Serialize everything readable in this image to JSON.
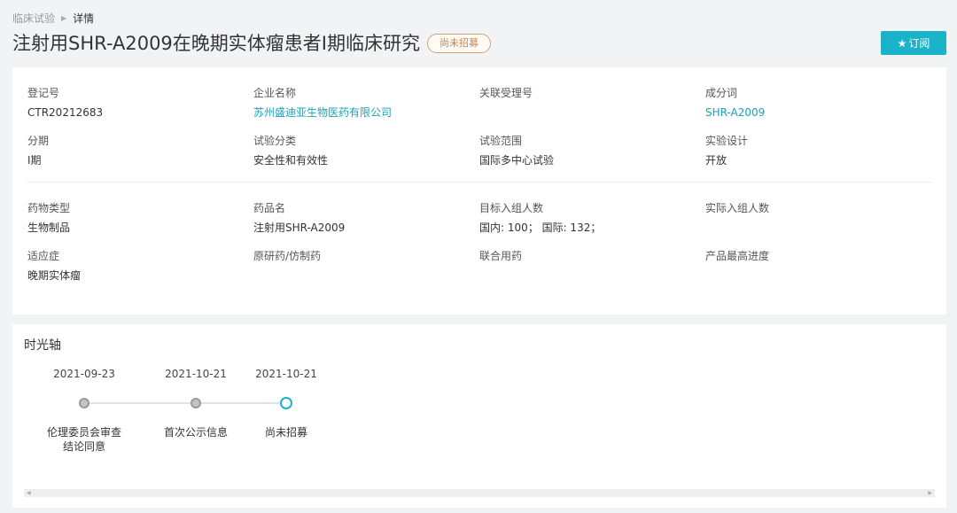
{
  "breadcrumb": {
    "root": "临床试验",
    "current": "详情"
  },
  "header": {
    "title": "注射用SHR-A2009在晚期实体瘤患者I期临床研究",
    "status": "尚未招募",
    "subscribe_label": "订阅"
  },
  "colors": {
    "accent": "#1bb3c9",
    "link": "#1aa3b8",
    "badge": "#b9875a"
  },
  "fields": {
    "reg_no": {
      "label": "登记号",
      "value": "CTR20212683"
    },
    "company": {
      "label": "企业名称",
      "value": "苏州盛迪亚生物医药有限公司"
    },
    "related_no": {
      "label": "关联受理号",
      "value": ""
    },
    "ingredient": {
      "label": "成分词",
      "value": "SHR-A2009"
    },
    "phase": {
      "label": "分期",
      "value": "I期"
    },
    "category": {
      "label": "试验分类",
      "value": "安全性和有效性"
    },
    "scope": {
      "label": "试验范围",
      "value": "国际多中心试验"
    },
    "design": {
      "label": "实验设计",
      "value": "开放"
    },
    "drug_type": {
      "label": "药物类型",
      "value": "生物制品"
    },
    "drug_name": {
      "label": "药品名",
      "value": "注射用SHR-A2009"
    },
    "target_enroll": {
      "label": "目标入组人数",
      "value": "国内: 100； 国际: 132；"
    },
    "actual_enroll": {
      "label": "实际入组人数",
      "value": ""
    },
    "indication": {
      "label": "适应症",
      "value": "晚期实体瘤"
    },
    "original_generic": {
      "label": "原研药/仿制药",
      "value": ""
    },
    "combination": {
      "label": "联合用药",
      "value": ""
    },
    "max_progress": {
      "label": "产品最高进度",
      "value": ""
    }
  },
  "timeline": {
    "title": "时光轴",
    "items": [
      {
        "date": "2021-09-23",
        "label": "伦理委员会审查\n结论同意",
        "state": "done"
      },
      {
        "date": "2021-10-21",
        "label": "首次公示信息",
        "state": "done"
      },
      {
        "date": "2021-10-21",
        "label": "尚未招募",
        "state": "current"
      }
    ]
  }
}
